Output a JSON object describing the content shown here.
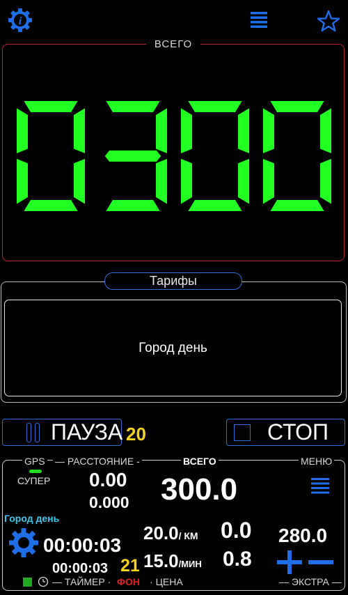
{
  "total": {
    "title": "ВСЕГО",
    "display": "0300"
  },
  "tariffs": {
    "title": "Тарифы",
    "selected": "Город день"
  },
  "controls": {
    "pause_label": "ПАУЗА",
    "pause_count": "20",
    "stop_label": "СТОП"
  },
  "status": {
    "gps_label": "GPS",
    "distance_label": "РАССТОЯНИЕ",
    "total_label": "ВСЕГО",
    "menu_label": "МЕНЮ",
    "super_label": "СУПЕР",
    "distance_value_1": "0.00",
    "distance_value_2": "0.000",
    "total_value": "300.0",
    "tariff_name": "Город день",
    "timer_main": "00:00:03",
    "timer_sub": "00:00:03",
    "timer_count": "21",
    "price_per_km": "20.0",
    "unit_km": "/ КМ",
    "price_per_min": "15.0",
    "unit_min": "/МИН",
    "km_total": "0.0",
    "min_total": "0.8",
    "extra_value": "280.0",
    "timer_label": "ТАЙМЕР",
    "background_label": "ФОН",
    "price_label": "ЦЕНА",
    "extra_label": "ЭКСТРА"
  },
  "colors": {
    "accent": "#1e6ee8",
    "digits": "#22ff22",
    "total_border": "#b3262a",
    "highlight": "#f5d21c",
    "tariff_text": "#37c9f0",
    "background_red": "#e02020",
    "gps_green": "#22dd22"
  },
  "icons": {
    "info": "info-gear-icon",
    "menu": "hamburger-icon",
    "favorite": "star-icon",
    "pause": "pause-icon",
    "stop": "stop-square-icon",
    "settings": "gear-icon",
    "plus": "plus-icon",
    "minus": "minus-icon",
    "clock": "clock-icon"
  }
}
